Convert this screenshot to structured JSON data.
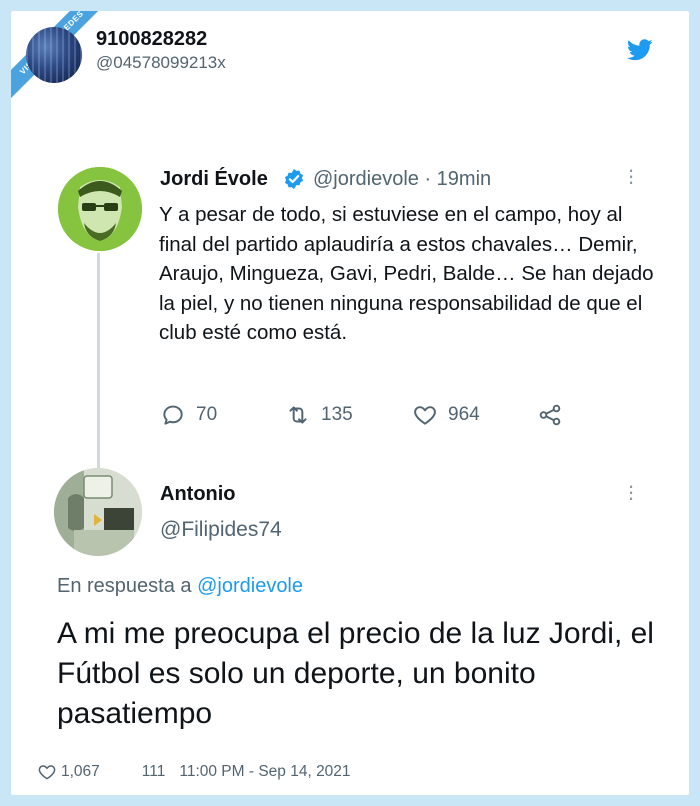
{
  "watermark": "VISTOENLASREDES",
  "author": {
    "name": "9100828282",
    "handle": "@04578099213x"
  },
  "quoted_tweet": {
    "name": "Jordi Évole",
    "handle_time": "@jordievole · 19min",
    "text": "Y a pesar de todo, si estuviese en  el campo, hoy al final del partido aplaudiría a estos chavales… Demir, Araujo, Mingueza, Gavi, Pedri, Balde…  Se han dejado la piel, y no tienen ninguna responsabilidad de que el club esté como está.",
    "replies": "70",
    "retweets": "135",
    "likes": "964"
  },
  "reply_tweet": {
    "name": "Antonio",
    "handle": "@Filipides74",
    "in_reply_prefix": "En respuesta a ",
    "in_reply_handle": "@jordievole",
    "text": "A mi me preocupa el precio de la luz Jordi, el Fútbol es solo un deporte, un bonito pasatiempo"
  },
  "footer": {
    "likes": "1,067",
    "comments": "111",
    "timestamp": "11:00 PM - Sep 14, 2021"
  },
  "colors": {
    "background": "#c9e6f7",
    "twitter_blue": "#1d9bf0",
    "muted_text": "#536471",
    "verified_blue": "#1d9bf0"
  },
  "icons": [
    "twitter-bird-icon",
    "verified-badge-icon",
    "more-options-icon",
    "reply-icon",
    "retweet-icon",
    "like-icon",
    "share-icon",
    "heart-outline-icon"
  ]
}
